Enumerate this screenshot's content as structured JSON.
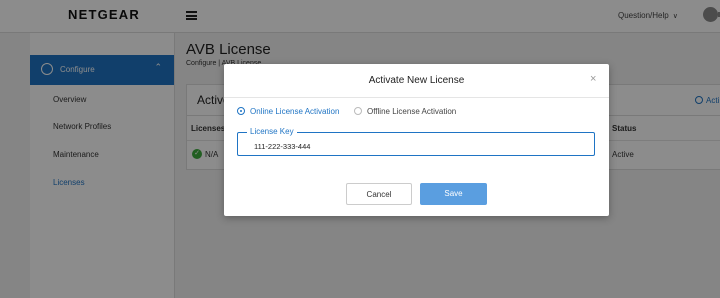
{
  "app": {
    "logo": "NETGEAR",
    "help_label": "Question/Help",
    "help_chevron": "∨"
  },
  "sidebar": {
    "section": "Configure",
    "items": [
      {
        "label": "Overview"
      },
      {
        "label": "Network Profiles"
      },
      {
        "label": "Maintenance"
      },
      {
        "label": "Licenses",
        "active": true
      }
    ]
  },
  "page": {
    "title": "AVB License",
    "breadcrumb": "Configure | AVB License"
  },
  "card": {
    "title": "Active",
    "action_label": "Acti",
    "headers": {
      "left": "Licenses",
      "right": "Status"
    },
    "row": {
      "left": "N/A",
      "right": "Active"
    }
  },
  "modal": {
    "title": "Activate New License",
    "close_glyph": "×",
    "options": {
      "online": "Online License Activation",
      "offline": "Offline License Activation",
      "selected": "online"
    },
    "field": {
      "label": "License Key",
      "value": "111-222-333-444"
    },
    "cancel_label": "Cancel",
    "save_label": "Save"
  },
  "colors": {
    "accent": "#1f74c4",
    "save_button": "#5a9ee0",
    "status_ok": "#3cab3c"
  }
}
